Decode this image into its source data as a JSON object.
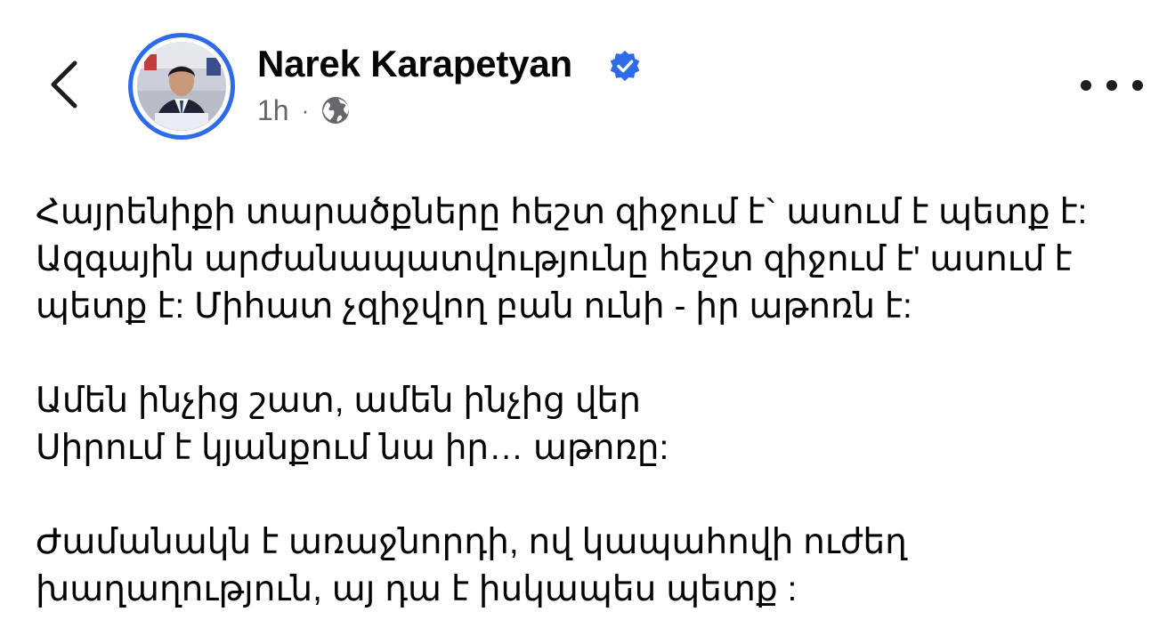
{
  "header": {
    "back_icon": "chevron-left-icon",
    "author_name": "Narek Karapetyan",
    "verified_icon": "verified-badge-icon",
    "time": "1h",
    "separator": "·",
    "audience_icon": "globe-icon",
    "more_icon": "more-horizontal-icon",
    "accent_color": "#2d6be8"
  },
  "post": {
    "paragraphs": [
      "Հայրենիքի տարածքները հեշտ զիջում է` ասում է պետք է:\nԱզգային արժանապատվությունը հեշտ զիջում է' ասում է պետք է: Միհատ չզիջվող բան ունի -  իր աթոռն է:",
      "Ամեն ինչից շատ, ամեն ինչից վեր\nՍիրում է կյանքում նա իր… աթոռը:",
      "Ժամանակն է առաջնորդի, ով կապահովի ուժեղ խաղաղություն,  այ դա է իսկապես պետք :"
    ]
  }
}
